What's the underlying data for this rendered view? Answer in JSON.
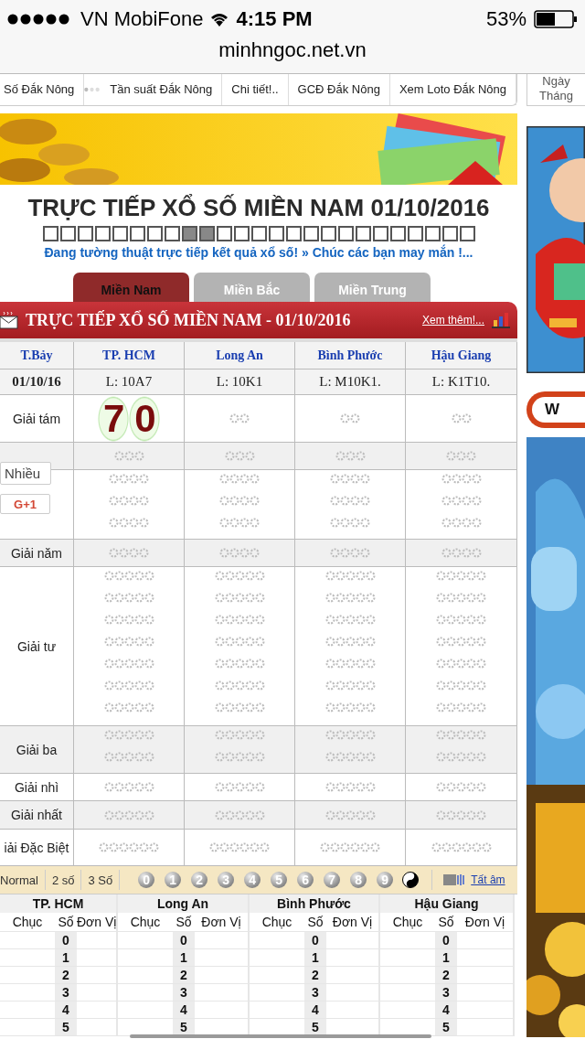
{
  "status_bar": {
    "carrier": "VN MobiFone",
    "time": "4:15 PM",
    "battery": "53%"
  },
  "url": "minhngoc.net.vn",
  "link_bar": [
    {
      "kind": "link",
      "label": "Số Đắk Nông"
    },
    {
      "kind": "dots"
    },
    {
      "kind": "link",
      "label": "Tần suất Đắk Nông"
    },
    {
      "kind": "link",
      "label": "Chi tiết!.."
    },
    {
      "kind": "link",
      "label": "GCĐ Đắk Nông"
    },
    {
      "kind": "link",
      "label": "Xem Loto Đắk Nông"
    }
  ],
  "title": "TRỰC TIẾP XỔ SỐ MIỀN NAM 01/10/2016",
  "progress_squares": [
    {
      "filled": false
    },
    {
      "filled": false
    },
    {
      "filled": false
    },
    {
      "filled": false
    },
    {
      "filled": false
    },
    {
      "filled": false
    },
    {
      "filled": false
    },
    {
      "filled": false
    },
    {
      "filled": true
    },
    {
      "filled": true
    },
    {
      "filled": false
    },
    {
      "filled": false
    },
    {
      "filled": false
    },
    {
      "filled": false
    },
    {
      "filled": false
    },
    {
      "filled": false
    },
    {
      "filled": false
    },
    {
      "filled": false
    },
    {
      "filled": false
    },
    {
      "filled": false
    },
    {
      "filled": false
    },
    {
      "filled": false
    },
    {
      "filled": false
    },
    {
      "filled": false
    },
    {
      "filled": false
    }
  ],
  "marquee": "Đang tường thuật trực tiếp kết quả xổ số! » Chúc các bạn may mắn !...",
  "tabs": [
    {
      "label": "Miền Nam",
      "selected": true
    },
    {
      "label": "Miền Bắc",
      "selected": false
    },
    {
      "label": "Miền Trung",
      "selected": false
    }
  ],
  "panel": {
    "title": "TRỰC TIẾP XỔ SỐ MIỀN NAM - 01/10/2016",
    "more": "Xem thêm!..."
  },
  "results": {
    "day": "T.Bảy",
    "date": "01/10/16",
    "provinces": [
      {
        "name": "TP. HCM",
        "ticket": "L: 10A7"
      },
      {
        "name": "Long An",
        "ticket": "L: 10K1"
      },
      {
        "name": "Bình Phước",
        "ticket": "L: M10K1."
      },
      {
        "name": "Hậu Giang",
        "ticket": "L: K1T10."
      }
    ],
    "rows": [
      {
        "kind": "g8",
        "label": "Giải tám",
        "cells": [
          {
            "value": "70"
          },
          {
            "loading": true
          },
          {
            "loading": true
          },
          {
            "loading": true
          }
        ]
      },
      {
        "kind": "g7",
        "cells": [
          {
            "loading": true
          },
          {
            "loading": true
          },
          {
            "loading": true
          },
          {
            "loading": true
          }
        ]
      },
      {
        "kind": "g6",
        "cells": [
          {
            "loading": true
          },
          {
            "loading": true
          },
          {
            "loading": true
          },
          {
            "loading": true
          }
        ]
      },
      {
        "kind": "g5",
        "label": "Giải năm",
        "cells": [
          {
            "loading": true
          },
          {
            "loading": true
          },
          {
            "loading": true
          },
          {
            "loading": true
          }
        ]
      },
      {
        "kind": "g4",
        "label": "Giải tư",
        "cells": [
          {
            "loading": true
          },
          {
            "loading": true
          },
          {
            "loading": true
          },
          {
            "loading": true
          }
        ]
      },
      {
        "kind": "g3",
        "label": "Giải ba",
        "cells": [
          {
            "loading": true
          },
          {
            "loading": true
          },
          {
            "loading": true
          },
          {
            "loading": true
          }
        ]
      },
      {
        "kind": "g2",
        "label": "Giải nhì",
        "cells": [
          {
            "loading": true
          },
          {
            "loading": true
          },
          {
            "loading": true
          },
          {
            "loading": true
          }
        ]
      },
      {
        "kind": "g1",
        "label": "Giải nhất",
        "cells": [
          {
            "loading": true
          },
          {
            "loading": true
          },
          {
            "loading": true
          },
          {
            "loading": true
          }
        ]
      },
      {
        "kind": "db",
        "label": "iải Đặc Biệt",
        "cells": [
          {
            "loading": true
          },
          {
            "loading": true
          },
          {
            "loading": true
          },
          {
            "loading": true
          }
        ]
      }
    ]
  },
  "share_popup": {
    "tooltip": "Nhiều",
    "button": "G+1"
  },
  "toolbar": {
    "modes": [
      "Normal",
      "2 số",
      "3 Số"
    ],
    "digits": [
      "0",
      "1",
      "2",
      "3",
      "4",
      "5",
      "6",
      "7",
      "8",
      "9"
    ],
    "mute": "Tất âm"
  },
  "loto": [
    {
      "name": "TP. HCM",
      "columns": [
        "Chục",
        "Số",
        "Đơn Vị"
      ],
      "digits": [
        "0",
        "1",
        "2",
        "3",
        "4",
        "5"
      ]
    },
    {
      "name": "Long An",
      "columns": [
        "Chục",
        "Số",
        "Đơn Vị"
      ],
      "digits": [
        "0",
        "1",
        "2",
        "3",
        "4",
        "5"
      ]
    },
    {
      "name": "Bình Phước",
      "columns": [
        "Chục",
        "Số",
        "Đơn Vị"
      ],
      "digits": [
        "0",
        "1",
        "2",
        "3",
        "4",
        "5"
      ]
    },
    {
      "name": "Hậu Giang",
      "columns": [
        "Chục",
        "Số",
        "Đơn Vị"
      ],
      "digits": [
        "0",
        "1",
        "2",
        "3",
        "4",
        "5"
      ]
    }
  ],
  "sidebar": {
    "calendar_lines": [
      "Ngày",
      "Tháng"
    ],
    "button": "W"
  }
}
